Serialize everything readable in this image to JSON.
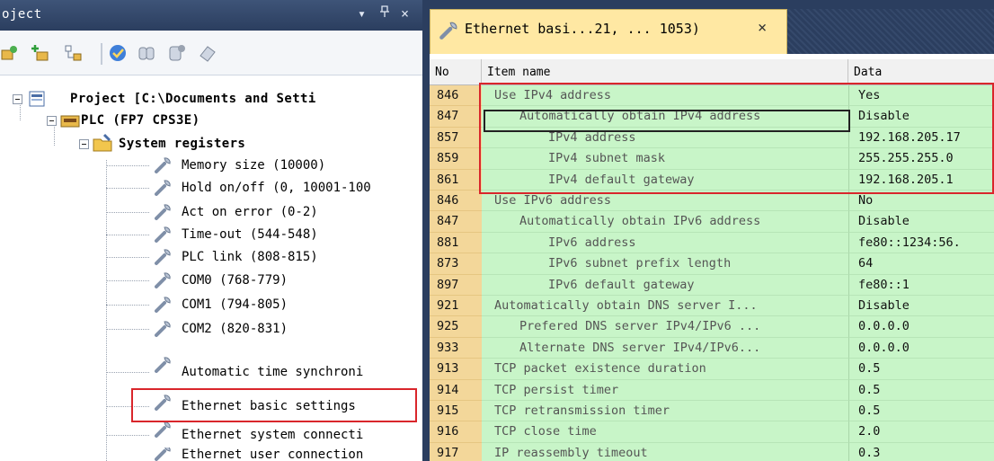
{
  "left_pane": {
    "title": "oject",
    "title_buttons": {
      "dropdown": "▾",
      "pin": "ᵖ",
      "close": "×"
    }
  },
  "tree": {
    "project": "Project [C:\\Documents and Setti",
    "plc": "PLC (FP7 CPS3E)",
    "system_registers": "System registers",
    "items": [
      "Memory size (10000)",
      "Hold on/off (0, 10001-100",
      "Act on error (0-2)",
      "Time-out (544-548)",
      "PLC link (808-815)",
      "COM0 (768-779)",
      "COM1 (794-805)",
      "COM2 (820-831)",
      "Automatic time synchroni",
      "Ethernet basic settings",
      "Ethernet system connecti",
      "Ethernet user connection"
    ]
  },
  "document_tab": {
    "label": "Ethernet basi...21, ... 1053)",
    "close": "×"
  },
  "grid": {
    "headers": {
      "no": "No",
      "item": "Item name",
      "data": "Data"
    },
    "rows": [
      {
        "no": "846",
        "item": "Use IPv4 address",
        "data": "Yes",
        "depth": 1
      },
      {
        "no": "847",
        "item": "Automatically obtain IPv4 address",
        "data": "Disable",
        "depth": 2
      },
      {
        "no": "857",
        "item": "IPv4 address",
        "data": "192.168.205.17",
        "depth": 3
      },
      {
        "no": "859",
        "item": "IPv4 subnet mask",
        "data": "255.255.255.0",
        "depth": 3
      },
      {
        "no": "861",
        "item": "IPv4 default gateway",
        "data": "192.168.205.1",
        "depth": 3
      },
      {
        "no": "846",
        "item": "Use IPv6 address",
        "data": "No",
        "depth": 1
      },
      {
        "no": "847",
        "item": "Automatically obtain IPv6 address",
        "data": "Disable",
        "depth": 2
      },
      {
        "no": "881",
        "item": "IPv6 address",
        "data": "fe80::1234:56.",
        "depth": 3
      },
      {
        "no": "873",
        "item": "IPv6 subnet prefix length",
        "data": "64",
        "depth": 3
      },
      {
        "no": "897",
        "item": "IPv6 default gateway",
        "data": "fe80::1",
        "depth": 3
      },
      {
        "no": "921",
        "item": "Automatically obtain DNS server I...",
        "data": "Disable",
        "depth": 1
      },
      {
        "no": "925",
        "item": "Prefered DNS server IPv4/IPv6 ...",
        "data": "0.0.0.0",
        "depth": 2
      },
      {
        "no": "933",
        "item": "Alternate DNS server IPv4/IPv6...",
        "data": "0.0.0.0",
        "depth": 2
      },
      {
        "no": "913",
        "item": "TCP packet existence duration",
        "data": "0.5",
        "depth": 1
      },
      {
        "no": "914",
        "item": "TCP persist timer",
        "data": "0.5",
        "depth": 1
      },
      {
        "no": "915",
        "item": "TCP retransmission timer",
        "data": "0.5",
        "depth": 1
      },
      {
        "no": "916",
        "item": "TCP close time",
        "data": "2.0",
        "depth": 1
      },
      {
        "no": "917",
        "item": "IP reassembly timeout",
        "data": "0.3",
        "depth": 1
      }
    ]
  },
  "colors": {
    "title_bar": "#2b3e5f",
    "tab_active": "#ffe8a3",
    "row_green": "#c8f5c8",
    "no_col": "#f3d79a",
    "highlight_red": "#d9262b"
  }
}
